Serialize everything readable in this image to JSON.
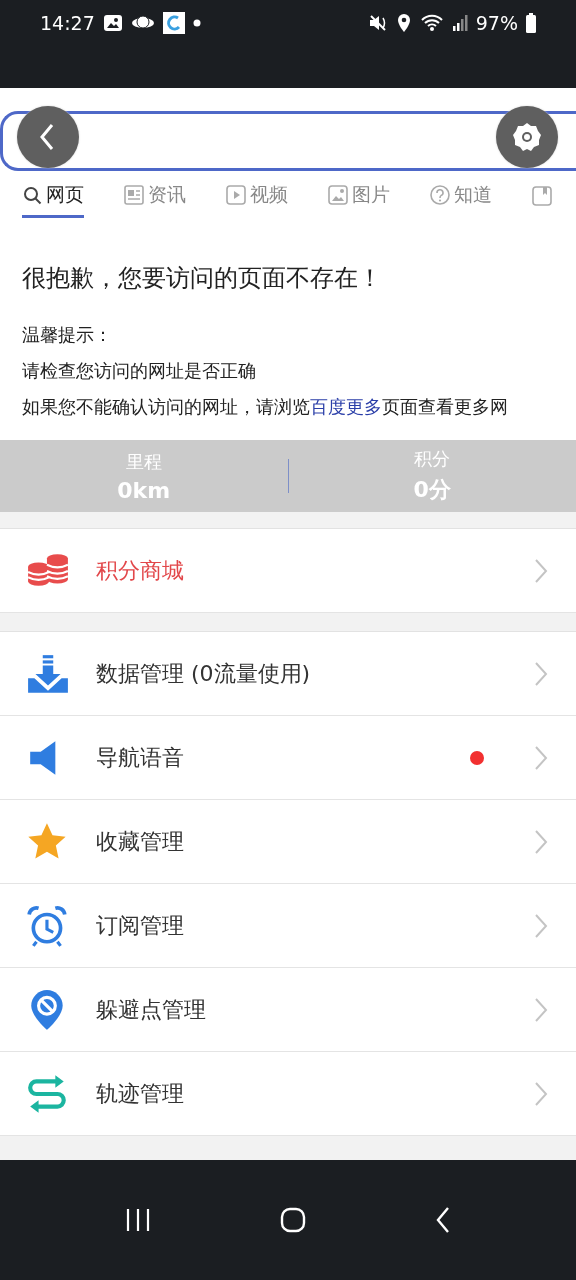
{
  "status_bar": {
    "time": "14:27",
    "battery": "97%"
  },
  "tabs": [
    {
      "label": "网页",
      "selected": true
    },
    {
      "label": "资讯",
      "selected": false
    },
    {
      "label": "视频",
      "selected": false
    },
    {
      "label": "图片",
      "selected": false
    },
    {
      "label": "知道",
      "selected": false
    }
  ],
  "error_page": {
    "title": "很抱歉，您要访问的页面不存在！",
    "tip_label": "温馨提示：",
    "tips": [
      "请检查您访问的网址是否正确",
      "如果您不能确认访问的网址，请浏览**百度更多**页面查看更多网"
    ]
  },
  "stats": [
    {
      "label": "里程",
      "value": "0km"
    },
    {
      "label": "积分",
      "value": "0分"
    }
  ],
  "menu_groups": [
    [
      {
        "label": "积分商城",
        "highlight": true,
        "dot": false
      }
    ],
    [
      {
        "label": "数据管理 (0流量使用)",
        "highlight": false,
        "dot": false
      },
      {
        "label": "导航语音",
        "highlight": false,
        "dot": true
      },
      {
        "label": "收藏管理",
        "highlight": false,
        "dot": false
      },
      {
        "label": "订阅管理",
        "highlight": false,
        "dot": false
      },
      {
        "label": "躲避点管理",
        "highlight": false,
        "dot": false
      },
      {
        "label": "轨迹管理",
        "highlight": false,
        "dot": false
      }
    ]
  ]
}
